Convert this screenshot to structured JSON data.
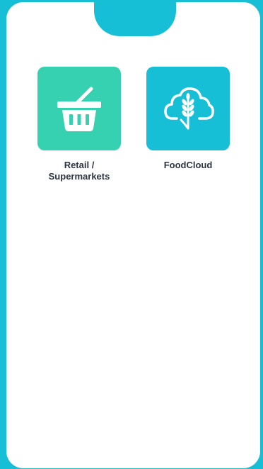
{
  "colors": {
    "frame": "#16bfd6",
    "screen": "#ffffff",
    "retail_tile": "#35d1b1",
    "foodcloud_tile": "#16bfd6",
    "label_text": "#2b3542",
    "icon_stroke": "#ffffff"
  },
  "apps": [
    {
      "label": "Retail /\nSupermarkets",
      "icon": "basket-icon"
    },
    {
      "label": "FoodCloud",
      "icon": "cloud-wheat-icon"
    }
  ]
}
